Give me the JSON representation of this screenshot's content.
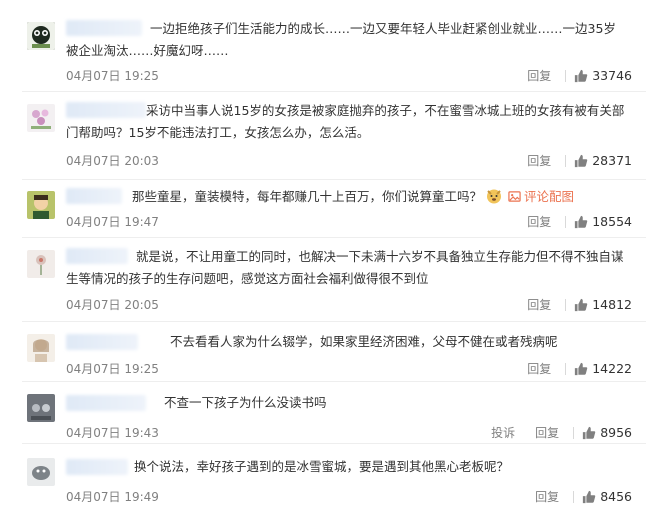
{
  "comments": [
    {
      "text": "一边拒绝孩子们生活能力的成长……一边又要年轻人毕业赶紧创业就业……一边35岁被企业淘汰……好魔幻呀……",
      "time": "04月07日 19:25",
      "reply": "回复",
      "likes": "33746",
      "avatar_color": "#3f4a3a"
    },
    {
      "text": "采访中当事人说15岁的女孩是被家庭抛弃的孩子，不在蜜雪冰城上班的女孩有被有关部门帮助吗？15岁不能违法打工，女孩怎么办，怎么活。",
      "time": "04月07日 20:03",
      "reply": "回复",
      "likes": "28371",
      "avatar_color": "#c9a3c2"
    },
    {
      "text": "那些童星，童装模特，每年都赚几十上百万，你们说算童工吗？",
      "emoji": "doge-face-icon",
      "link": "评论配图",
      "time": "04月07日 19:47",
      "reply": "回复",
      "likes": "18554",
      "avatar_color": "#6b7a2a"
    },
    {
      "text": "就是说，不让用童工的同时，也解决一下未满十六岁不具备独立生存能力但不得不独自谋生等情况的孩子的生存问题吧，感觉这方面社会福利做得很不到位",
      "time": "04月07日 20:05",
      "reply": "回复",
      "likes": "14812",
      "avatar_color": "#e6e0dc"
    },
    {
      "text": "不去看看人家为什么辍学，如果家里经济困难，父母不健在或者残病呢",
      "time": "04月07日 19:25",
      "reply": "回复",
      "likes": "14222",
      "avatar_color": "#d8cfc4"
    },
    {
      "text": "不查一下孩子为什么没读书吗",
      "time": "04月07日 19:43",
      "report": "投诉",
      "reply": "回复",
      "likes": "8956",
      "avatar_color": "#8a8f96"
    },
    {
      "text": "换个说法，幸好孩子遇到的是冰雪蜜城，要是遇到其他黑心老板呢？",
      "time": "04月07日 19:49",
      "reply": "回复",
      "likes": "8456",
      "avatar_color": "#9aa0a4"
    }
  ]
}
